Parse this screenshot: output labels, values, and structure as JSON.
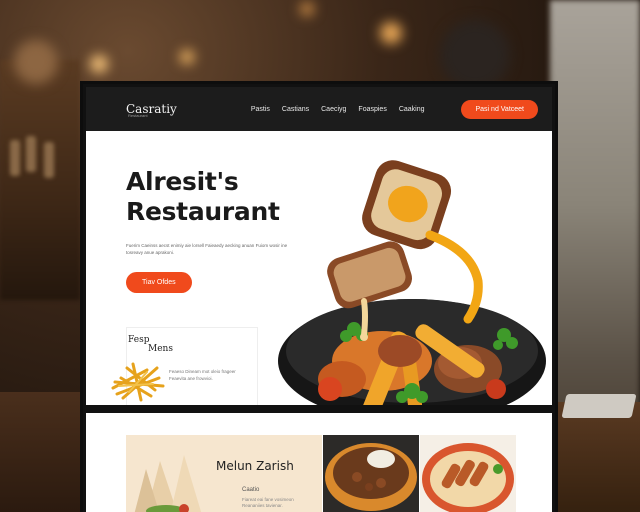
{
  "navbar": {
    "logo": "Casratiy",
    "logo_sub": "Restaurant",
    "links": [
      "Pastis",
      "Castians",
      "Caeciyg",
      "Foaspies",
      "Caaking"
    ],
    "cta": "Pasi nd Vatceet"
  },
  "hero": {
    "title_line1": "Alresit's",
    "title_line2": "Restaurant",
    "description": "Fuerim Caeinss aecst enimiy aie lorsell Faieaedy aecking anuan Fuiom wosir ine tosreavy anue aprakoni.",
    "cta": "Tiav Ofdes"
  },
  "menu_card": {
    "title_line1": "Fesp",
    "title_line2": "Mens",
    "description": "Feaeso Dineam mot oleio frageer Feaevita ane frowvioi."
  },
  "bottom": {
    "card_title": "Melun Zarish",
    "card_subtitle": "Caatio",
    "card_description": "Fiareat eai fane vosimeon Reananiies tavienar."
  },
  "colors": {
    "accent": "#f04a1c",
    "navbar_bg": "#1c1c1c",
    "text_dark": "#1a1a1a"
  }
}
